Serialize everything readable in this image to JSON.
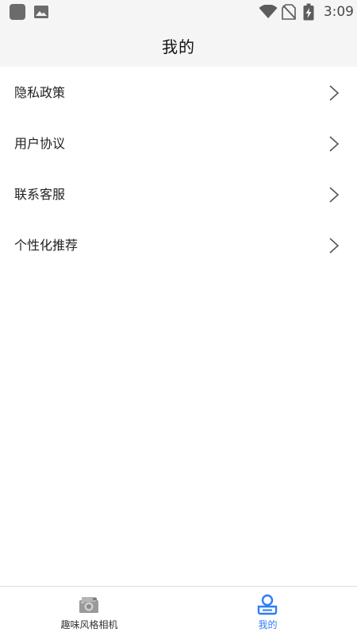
{
  "status_bar": {
    "time": "3:09",
    "icons": [
      "app-icon",
      "image-icon",
      "wifi-icon",
      "no-sim-icon",
      "battery-charging-icon"
    ]
  },
  "header": {
    "title": "我的"
  },
  "menu": {
    "items": [
      {
        "label": "隐私政策",
        "icon": "chevron-right-icon"
      },
      {
        "label": "用户协议",
        "icon": "chevron-right-icon"
      },
      {
        "label": "联系客服",
        "icon": "chevron-right-icon"
      },
      {
        "label": "个性化推荐",
        "icon": "chevron-right-icon"
      }
    ]
  },
  "bottom_nav": {
    "tabs": [
      {
        "label": "趣味风格相机",
        "icon": "camera-icon",
        "active": false
      },
      {
        "label": "我的",
        "icon": "user-icon",
        "active": true
      }
    ]
  },
  "colors": {
    "header_bg": "#f5f5f5",
    "active_tab": "#2f7ef6",
    "inactive_tab_text": "#333333"
  }
}
